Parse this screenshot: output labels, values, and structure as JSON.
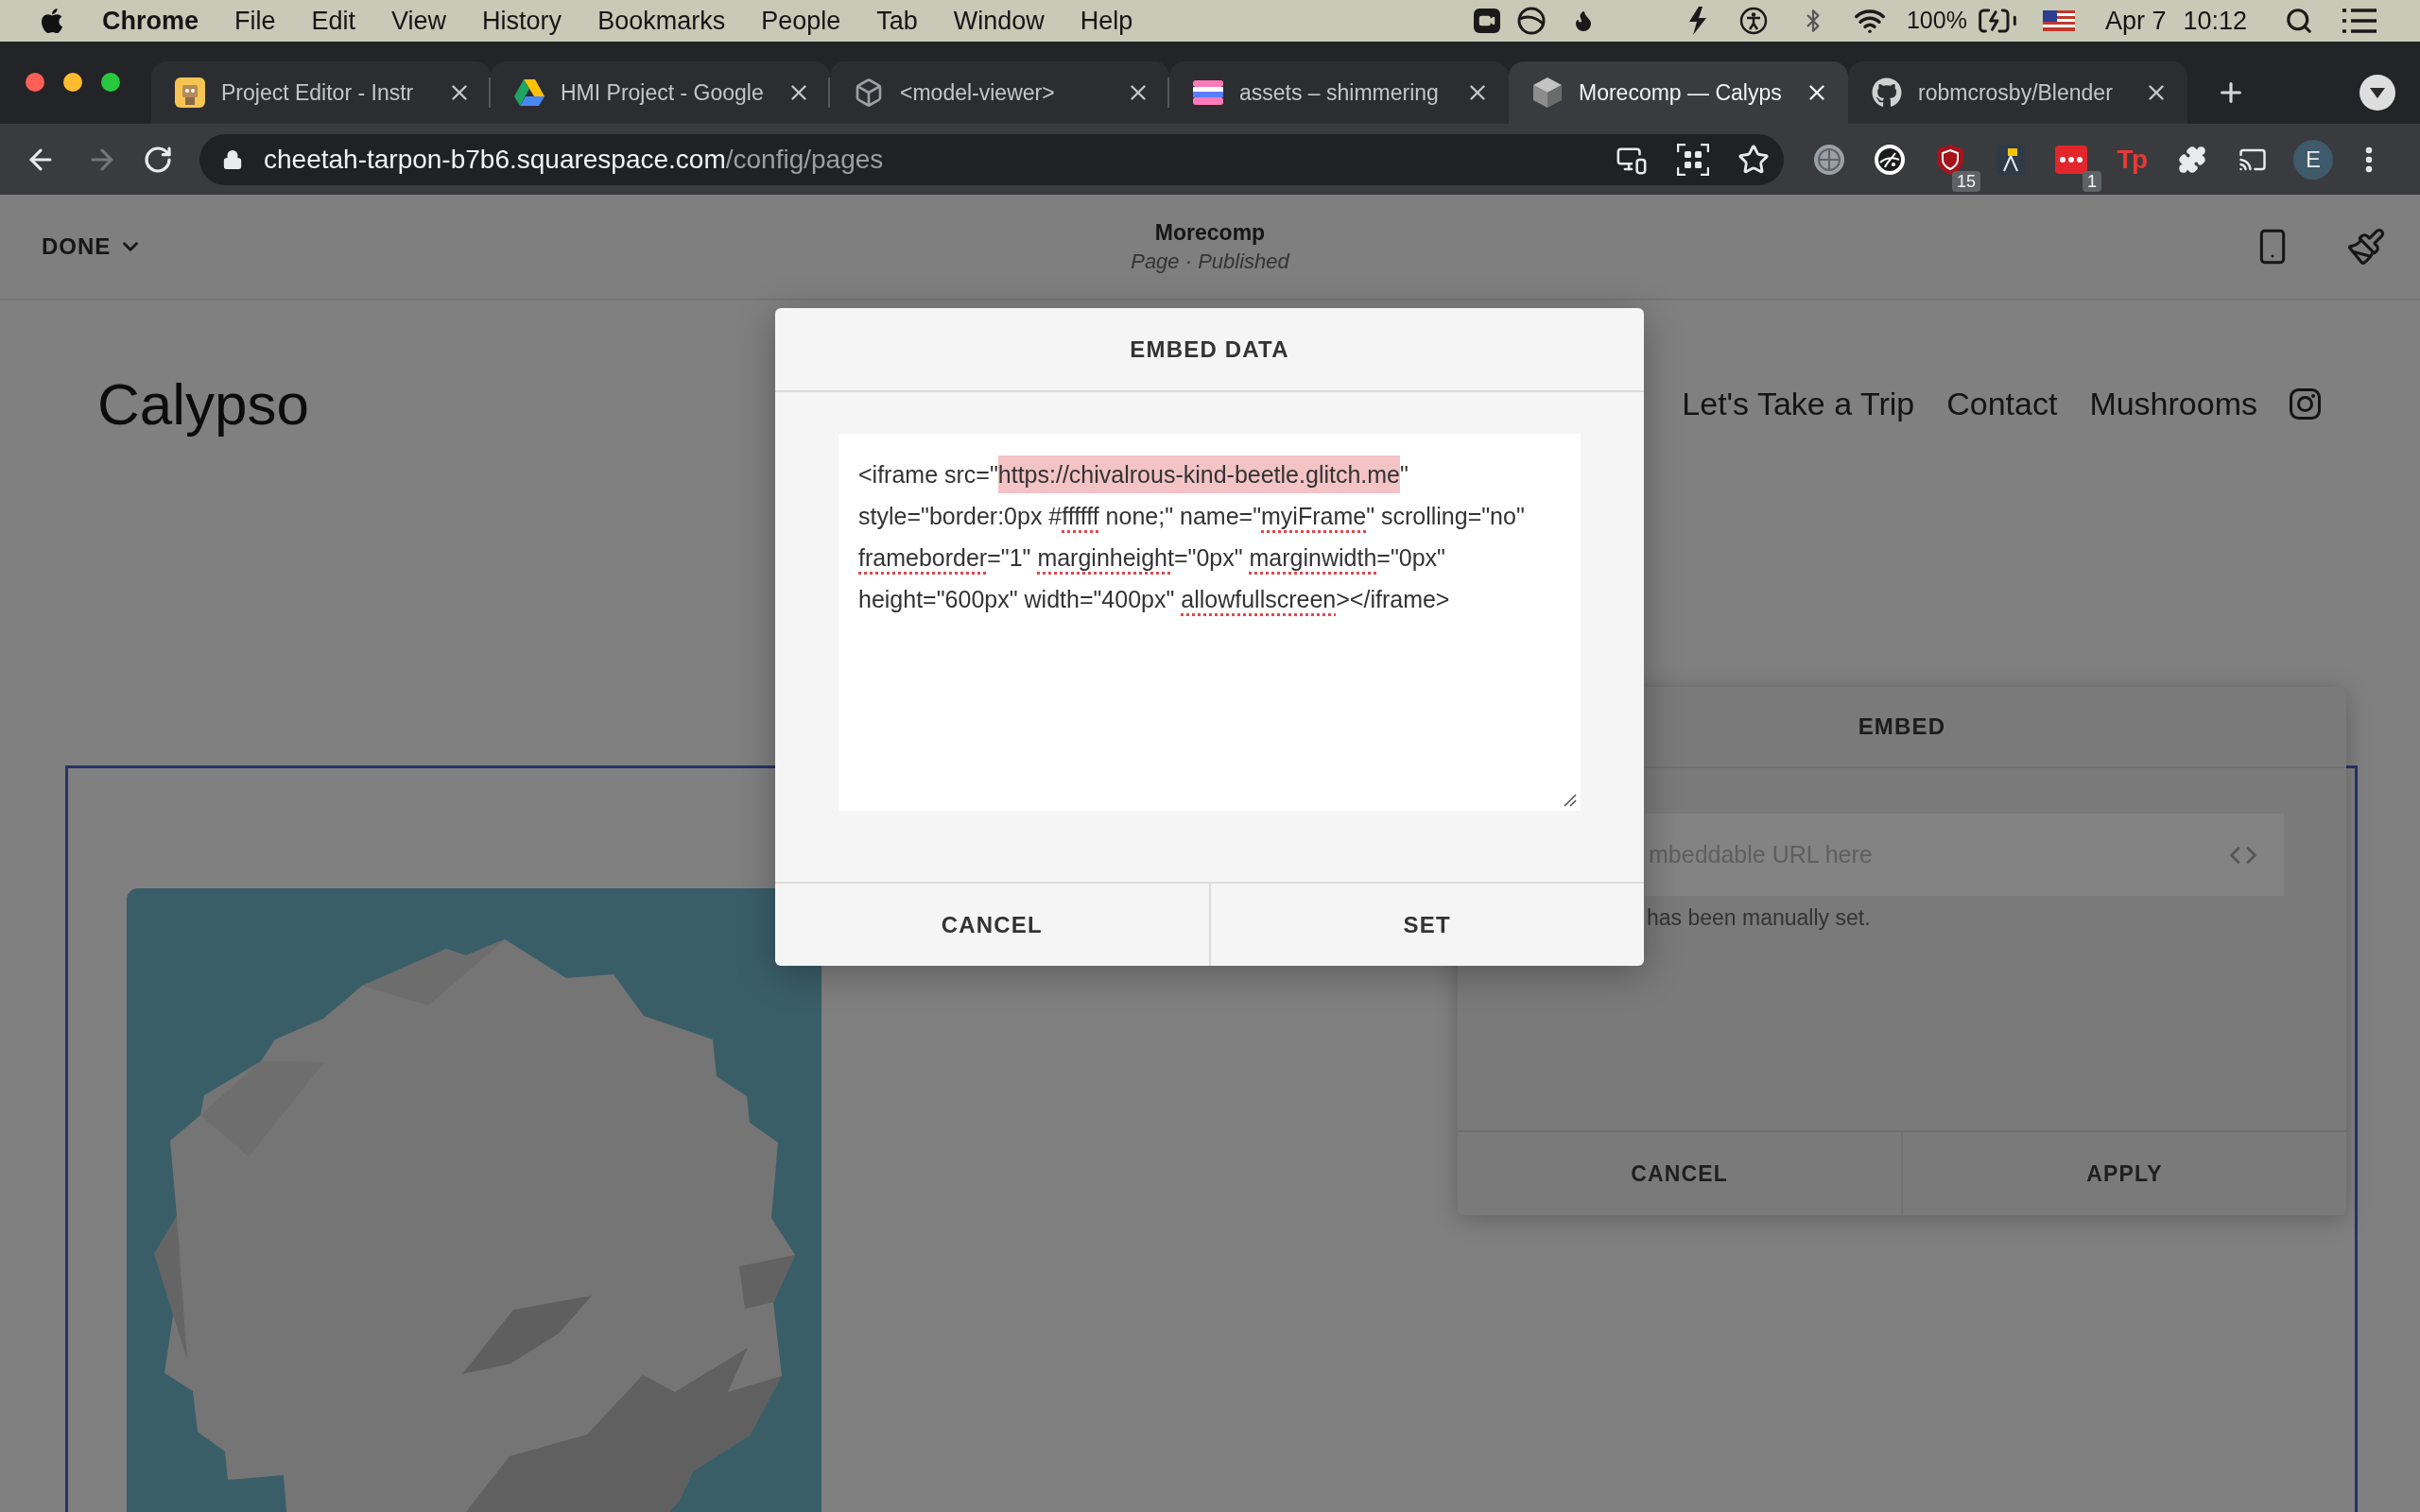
{
  "menu_bar": {
    "app_name": "Chrome",
    "menus": [
      "File",
      "Edit",
      "View",
      "History",
      "Bookmarks",
      "People",
      "Tab",
      "Window",
      "Help"
    ],
    "battery_percent": "100%",
    "date": "Apr 7",
    "time": "10:12"
  },
  "browser": {
    "tabs": [
      {
        "title": "Project Editor - Instr",
        "kind": "robot",
        "selected": false
      },
      {
        "title": "HMI Project - Google",
        "kind": "triangle",
        "selected": false
      },
      {
        "title": "<model-viewer>",
        "kind": "wireframe",
        "selected": false
      },
      {
        "title": "assets – shimmering",
        "kind": "stripes",
        "selected": false
      },
      {
        "title": "Morecomp — Calyps",
        "kind": "cube",
        "selected": true
      },
      {
        "title": "robmcrosby/Blender",
        "kind": "cat",
        "selected": false
      }
    ],
    "forward": {
      "disabled": true
    },
    "address": {
      "host": "cheetah-tarpon-b7b6.squarespace.com",
      "path": "/config/pages"
    },
    "extensions": [
      {
        "kind": "ball"
      },
      {
        "kind": "emblem"
      },
      {
        "kind": "shield",
        "badge": "15"
      },
      {
        "kind": "lamp"
      },
      {
        "kind": "dots",
        "badge": "1"
      },
      {
        "kind": "letters",
        "label": "Tp"
      },
      {
        "kind": "puzzle"
      },
      {
        "kind": "cast"
      }
    ],
    "profile_initial": "E"
  },
  "editor_header": {
    "done_label": "DONE",
    "page_title": "Morecomp",
    "page_status": "Page · Published"
  },
  "site": {
    "logo": "Calypso",
    "nav": [
      "Let's Take a Trip",
      "Contact",
      "Mushrooms"
    ]
  },
  "content_block": {
    "selected": true
  },
  "embed_panel": {
    "title": "EMBED",
    "url_placeholder": "mbeddable URL here",
    "note": "has been manually set.",
    "buttons": [
      "CANCEL",
      "APPLY"
    ]
  },
  "embed_data_dialog": {
    "title": "EMBED DATA",
    "code_lines": [
      [
        {
          "kind": "plain",
          "text": "<iframe src=\""
        },
        {
          "kind": "highlighted",
          "text": "https://chivalrous-kind-beetle.glitch.me"
        },
        {
          "kind": "plain",
          "text": "\""
        }
      ],
      [
        {
          "kind": "plain",
          "text": "style=\"border:0px #"
        },
        {
          "kind": "misspelled",
          "text": "ffffff"
        },
        {
          "kind": "plain",
          "text": " none;\" name=\""
        },
        {
          "kind": "misspelled",
          "text": "myiFrame"
        },
        {
          "kind": "plain",
          "text": "\" scrolling=\"no\""
        }
      ],
      [
        {
          "kind": "misspelled",
          "text": "frameborder"
        },
        {
          "kind": "plain",
          "text": "=\"1\" "
        },
        {
          "kind": "misspelled",
          "text": "marginheight"
        },
        {
          "kind": "plain",
          "text": "=\"0px\" "
        },
        {
          "kind": "misspelled",
          "text": "marginwidth"
        },
        {
          "kind": "plain",
          "text": "=\"0px\""
        }
      ],
      [
        {
          "kind": "plain",
          "text": "height=\"600px\" width=\"400px\" "
        },
        {
          "kind": "misspelled",
          "text": "allowfullscreen"
        },
        {
          "kind": "plain",
          "text": "></iframe>"
        }
      ]
    ],
    "buttons": [
      "CANCEL",
      "SET"
    ]
  }
}
